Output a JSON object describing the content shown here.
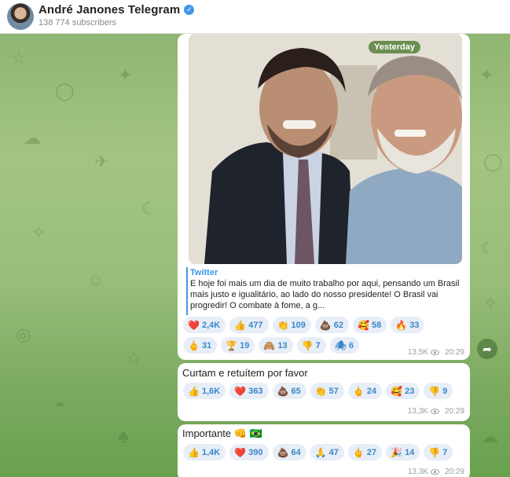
{
  "header": {
    "title": "André Janones Telegram",
    "subscribers": "138 774 subscribers"
  },
  "icons": {
    "verified": "verified-badge-icon",
    "views": "eye-icon",
    "share": "share-arrow-icon"
  },
  "messages": [
    {
      "photo_tag": "Yesterday",
      "preview_source": "Twitter",
      "preview_text": "E hoje foi mais um dia de muito trabalho por aqui, pensando um Brasil mais justo e igualitário, ao lado do nosso presidente! O Brasil vai progredir! O combate à fome, a g...",
      "reactions_row1": [
        {
          "emoji": "❤️",
          "count": "2,4K"
        },
        {
          "emoji": "👍",
          "count": "477"
        },
        {
          "emoji": "👏",
          "count": "109"
        },
        {
          "emoji": "💩",
          "count": "62"
        },
        {
          "emoji": "🥰",
          "count": "58"
        },
        {
          "emoji": "🔥",
          "count": "33"
        }
      ],
      "reactions_row2": [
        {
          "emoji": "🖕",
          "count": "31"
        },
        {
          "emoji": "🏆",
          "count": "19"
        },
        {
          "emoji": "🙈",
          "count": "13"
        },
        {
          "emoji": "👎",
          "count": "7"
        },
        {
          "emoji": "🕷",
          "count": "6"
        }
      ],
      "views": "13,5K",
      "time": "20:29"
    },
    {
      "text": "Curtam e retuítem por favor",
      "reactions": [
        {
          "emoji": "👍",
          "count": "1,6K"
        },
        {
          "emoji": "❤️",
          "count": "363"
        },
        {
          "emoji": "💩",
          "count": "65"
        },
        {
          "emoji": "👏",
          "count": "57"
        },
        {
          "emoji": "🖕",
          "count": "24"
        },
        {
          "emoji": "🥰",
          "count": "23"
        },
        {
          "emoji": "👎",
          "count": "9"
        }
      ],
      "views": "13,3K",
      "time": "20:29"
    },
    {
      "text": "Importante 👊 🇧🇷",
      "reactions": [
        {
          "emoji": "👍",
          "count": "1,4K"
        },
        {
          "emoji": "❤️",
          "count": "390"
        },
        {
          "emoji": "💩",
          "count": "64"
        },
        {
          "emoji": "🙏",
          "count": "47"
        },
        {
          "emoji": "🖕",
          "count": "27"
        },
        {
          "emoji": "🎉",
          "count": "14"
        },
        {
          "emoji": "👎",
          "count": "7"
        }
      ],
      "views": "13,3K",
      "time": "20:29"
    }
  ]
}
